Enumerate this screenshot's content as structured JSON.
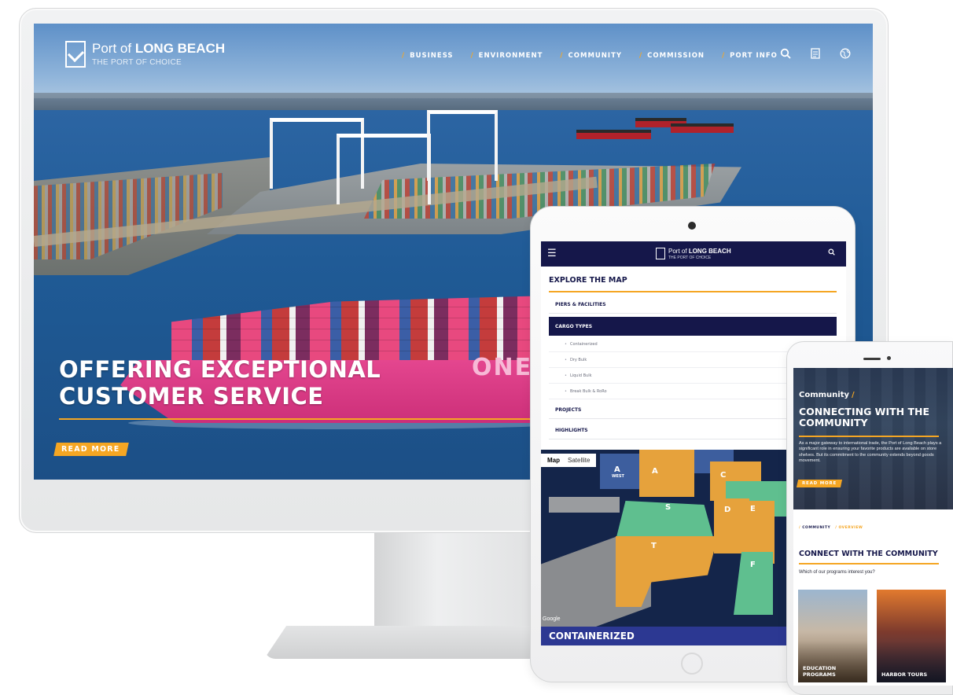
{
  "desktop": {
    "brand_prefix": "Port of",
    "brand_name": "LONG BEACH",
    "tagline": "THE PORT OF CHOICE",
    "nav": [
      "BUSINESS",
      "ENVIRONMENT",
      "COMMUNITY",
      "COMMISSION",
      "PORT INFO"
    ],
    "icons": [
      "search-icon",
      "document-icon",
      "globe-icon"
    ],
    "hero_line1": "OFFERING EXCEPTIONAL",
    "hero_line2": "CUSTOMER SERVICE",
    "read_more": "READ MORE",
    "ship_logo": "ONE"
  },
  "tablet": {
    "brand_prefix": "Port of",
    "brand_name": "LONG BEACH",
    "tagline": "THE PORT OF CHOICE",
    "heading": "EXPLORE THE MAP",
    "menu": [
      {
        "label": "PIERS & FACILITIES",
        "active": false
      },
      {
        "label": "CARGO TYPES",
        "active": true
      },
      {
        "label": "PROJECTS",
        "active": false
      },
      {
        "label": "HIGHLIGHTS",
        "active": false
      }
    ],
    "cargo_sub_items": [
      "Containerized",
      "Dry Bulk",
      "Liquid Bulk",
      "Break Bulk & RoRo"
    ],
    "map_toggle": [
      "Map",
      "Satellite"
    ],
    "map_labels": [
      "A",
      "WEST",
      "A",
      "C",
      "S",
      "D",
      "E",
      "T",
      "F"
    ],
    "map_attribution": "Google",
    "caption": "CONTAINERIZED"
  },
  "phone": {
    "breadcrumb": "Community",
    "hero_title": "CONNECTING WITH THE COMMUNITY",
    "hero_body": "As a major gateway to international trade, the Port of Long Beach plays a significant role in ensuring your favorite products are available on store shelves. But its commitment to the community extends beyond goods movement.",
    "read_more": "READ MORE",
    "crumbs": [
      "COMMUNITY",
      "OVERVIEW"
    ],
    "section_title": "CONNECT WITH THE COMMUNITY",
    "question": "Which of our programs interest you?",
    "cards": [
      "EDUCATION PROGRAMS",
      "HARBOR TOURS"
    ]
  },
  "colors": {
    "navy": "#15174a",
    "accent": "#f5a623",
    "ship_pink": "#e4468f",
    "map_orange": "#e6a23c",
    "map_green": "#5fbf8f",
    "map_blue": "#2c3892"
  }
}
